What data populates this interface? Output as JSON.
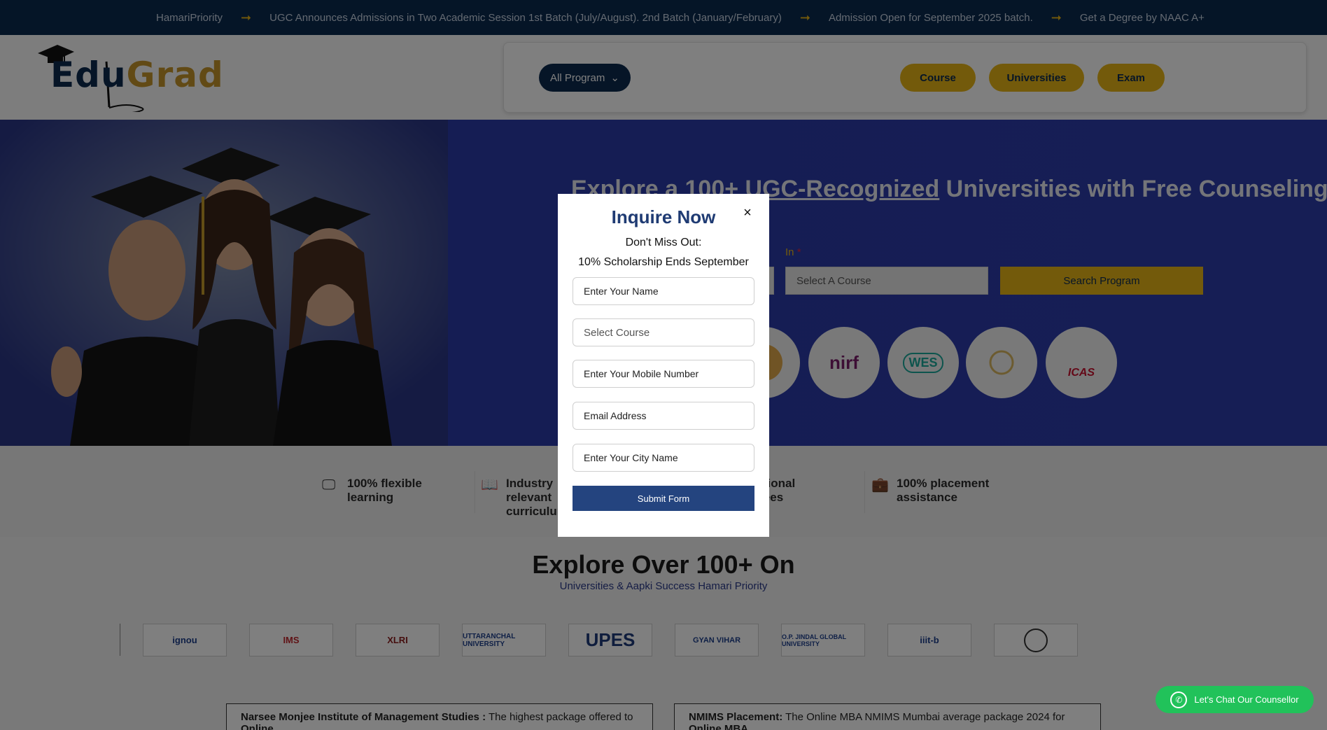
{
  "ticker": {
    "items": [
      "HamariPriority",
      "UGC Announces Admissions in Two Academic Session 1st Batch (July/August). 2nd Batch (January/February)",
      "Admission Open for September 2025 batch.",
      "Get a Degree by NAAC A+"
    ]
  },
  "header": {
    "logo_text_a": "Edu",
    "logo_text_b": "Grad",
    "all_program": "All Program",
    "nav": [
      "Course",
      "Universities",
      "Exam"
    ]
  },
  "hero": {
    "title_a": "Explore a 100+ ",
    "title_link": "UGC-Recognized",
    "title_b": " Universities with Free Counseling by",
    "in_label": "In",
    "required_mark": "*",
    "select_course": "Select A Course",
    "search_button": "Search Program",
    "badges": [
      "nirf",
      "WES",
      "",
      "ICAS"
    ]
  },
  "features": [
    {
      "text": "100% flexible learning"
    },
    {
      "text": "Industry relevant curriculum"
    },
    {
      "text": "traditional degrees"
    },
    {
      "text": "100% placement assistance"
    }
  ],
  "explore": {
    "title": "Explore Over 100+ On",
    "subtitle": "Universities & Aapki Success Hamari Priority",
    "logos": [
      "ignou",
      "IMS",
      "XLRI",
      "UTTARANCHAL UNIVERSITY",
      "UPES",
      "GYAN VIHAR",
      "O.P. JINDAL GLOBAL UNIVERSITY",
      "iiit-b",
      ""
    ],
    "placement_left_bold": "Narsee Monjee Institute of Management Studies :",
    "placement_left_text": " The highest package offered to ",
    "placement_left_bold2": "Online",
    "placement_right_bold": "NMIMS Placement:",
    "placement_right_text": " The Online MBA NMIMS Mumbai average package 2024 for ",
    "placement_right_bold2": "Online MBA"
  },
  "modal": {
    "title": "Inquire Now",
    "sub1": "Don't Miss Out:",
    "sub2": "10% Scholarship Ends September",
    "name_placeholder": "Enter Your Name",
    "course_placeholder": "Select Course",
    "mobile_placeholder": "Enter Your Mobile Number",
    "email_placeholder": "Email Address",
    "city_placeholder": "Enter Your City Name",
    "submit": "Submit Form",
    "close": "×"
  },
  "chat": {
    "label": "Let's Chat Our Counsellor"
  },
  "colors": {
    "navy": "#0d2a4f",
    "gold": "#e6b417",
    "hero_blue": "#2d3cab",
    "submit_blue": "#24447f",
    "whatsapp_green": "#21c25a"
  }
}
